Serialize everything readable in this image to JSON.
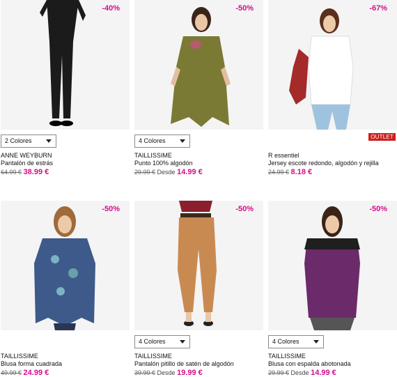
{
  "colors": {
    "discount": "#d40c8c",
    "outlet_bg": "#cc1f1f"
  },
  "products": [
    {
      "discount": "-40%",
      "select": "2 Colores",
      "brand": "ANNE WEYBURN",
      "title": "Pantalón de estrás",
      "old_price": "64.99 €",
      "desde": "",
      "price": "38.99 €"
    },
    {
      "discount": "-50%",
      "select": "4 Colores",
      "brand": "TAILLISSIME",
      "title": "Punto 100% algodón",
      "old_price": "29.99 €",
      "desde": "Desde",
      "price": "14.99 €"
    },
    {
      "discount": "-67%",
      "outlet": "OUTLET",
      "brand": "R essentiel",
      "title": "Jersey escote redondo, algodón y rejilla",
      "old_price": "24.99 €",
      "desde": "",
      "price": "8.18 €"
    },
    {
      "discount": "-50%",
      "brand": "TAILLISSIME",
      "title": "Blusa forma cuadrada",
      "old_price": "49.99 €",
      "desde": "",
      "price": "24.99 €"
    },
    {
      "discount": "-50%",
      "select": "4 Colores",
      "brand": "TAILLISSIME",
      "title": "Pantalón pitillo de satén de algodón",
      "old_price": "39.99 €",
      "desde": "Desde",
      "price": "19.99 €"
    },
    {
      "discount": "-50%",
      "select": "4 Colores",
      "brand": "TAILLISSIME",
      "title": "Blusa con espalda abotonada",
      "old_price": "29.99 €",
      "desde": "Desde",
      "price": "14.99 €"
    }
  ]
}
